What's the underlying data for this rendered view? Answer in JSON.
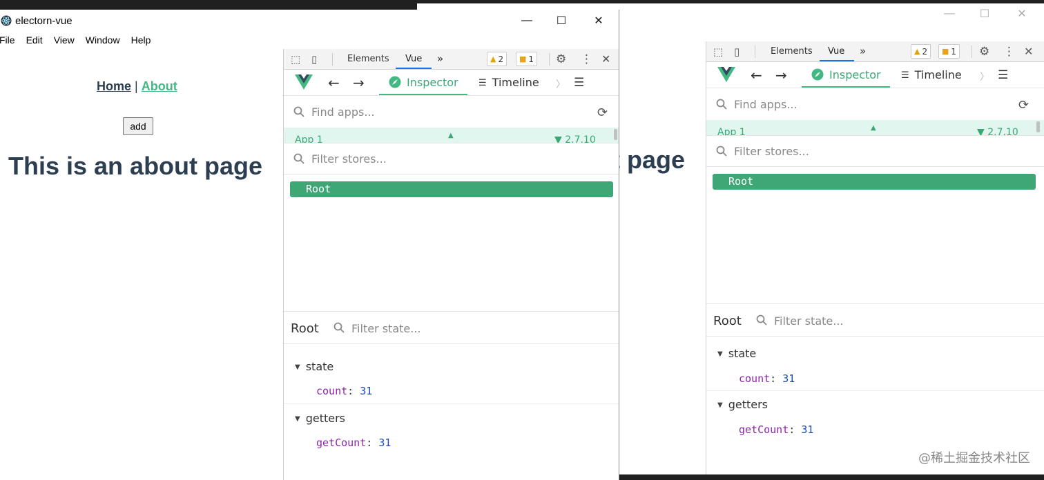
{
  "front_window": {
    "title": "electorn-vue",
    "controls": {
      "minimize": "—",
      "maximize": "☐",
      "close": "✕"
    },
    "menu": [
      "File",
      "Edit",
      "View",
      "Window",
      "Help"
    ]
  },
  "app": {
    "nav": {
      "home": "Home",
      "separator": "|",
      "about": "About"
    },
    "add_button": "add",
    "heading": "This is an about page"
  },
  "back_window": {
    "controls": {
      "minimize": "—",
      "maximize": "☐",
      "close": "✕"
    },
    "heading_fragment": "t page"
  },
  "devtools": {
    "tabs": {
      "elements": "Elements",
      "vue": "Vue",
      "more": "»"
    },
    "warnings_count": "2",
    "errors_count": "1",
    "vue_toolbar": {
      "inspector": "Inspector",
      "timeline": "Timeline"
    },
    "find_apps_placeholder": "Find apps...",
    "app_item": {
      "name": "App 1",
      "version": "2.7.10"
    },
    "filter_stores_placeholder": "Filter stores...",
    "root_store": "Root",
    "state_panel": {
      "title": "Root",
      "filter_placeholder": "Filter state...",
      "state_label": "state",
      "getters_label": "getters",
      "state_key": "count",
      "state_value": "31",
      "getter_key": "getCount",
      "getter_value": "31"
    }
  },
  "watermark": "@稀土掘金技术社区",
  "colors": {
    "vue_green": "#42b983",
    "store_selected": "#3ea775",
    "heading": "#2c3e50",
    "key_purple": "#8e24aa",
    "number_blue": "#1a4bb8"
  }
}
